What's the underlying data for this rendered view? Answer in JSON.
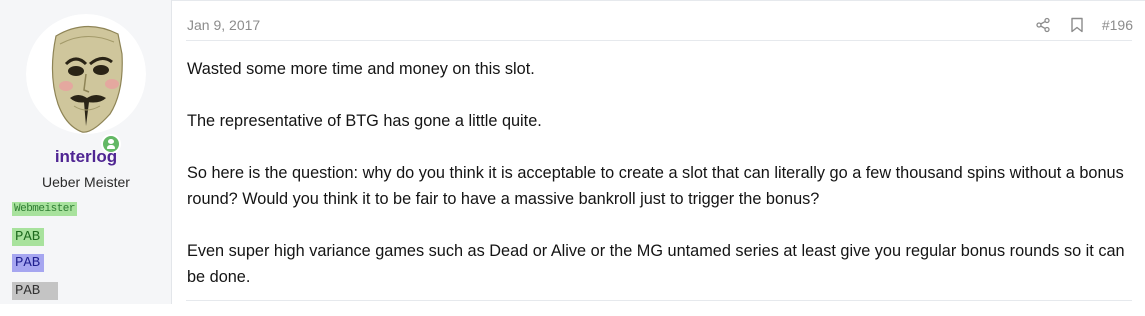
{
  "user": {
    "name": "interlog",
    "title": "Ueber Meister",
    "banners": [
      "Webmeister",
      "PAB",
      "PAB",
      "PAB"
    ],
    "status": "online"
  },
  "post": {
    "date": "Jan 9, 2017",
    "number": "#196",
    "paragraphs": [
      "Wasted some more time and money on this slot.",
      "The representative of BTG has gone a little quite.",
      "So here is the question: why do you think it is acceptable to create a slot that can literally go a few thousand spins without a bonus round? Would you think it to be fair to have a massive bankroll just to trigger the bonus?",
      "Even super high variance games such as Dead or Alive or the MG untamed series at least give you regular bonus rounds so it can be done."
    ]
  },
  "icons": {
    "share": "share-icon",
    "bookmark": "bookmark-icon",
    "online": "online-status-icon"
  },
  "colors": {
    "username": "#4f2593",
    "sidebar_bg": "#f5f6f8",
    "meta_text": "#8c8c8c",
    "online": "#63b865"
  }
}
